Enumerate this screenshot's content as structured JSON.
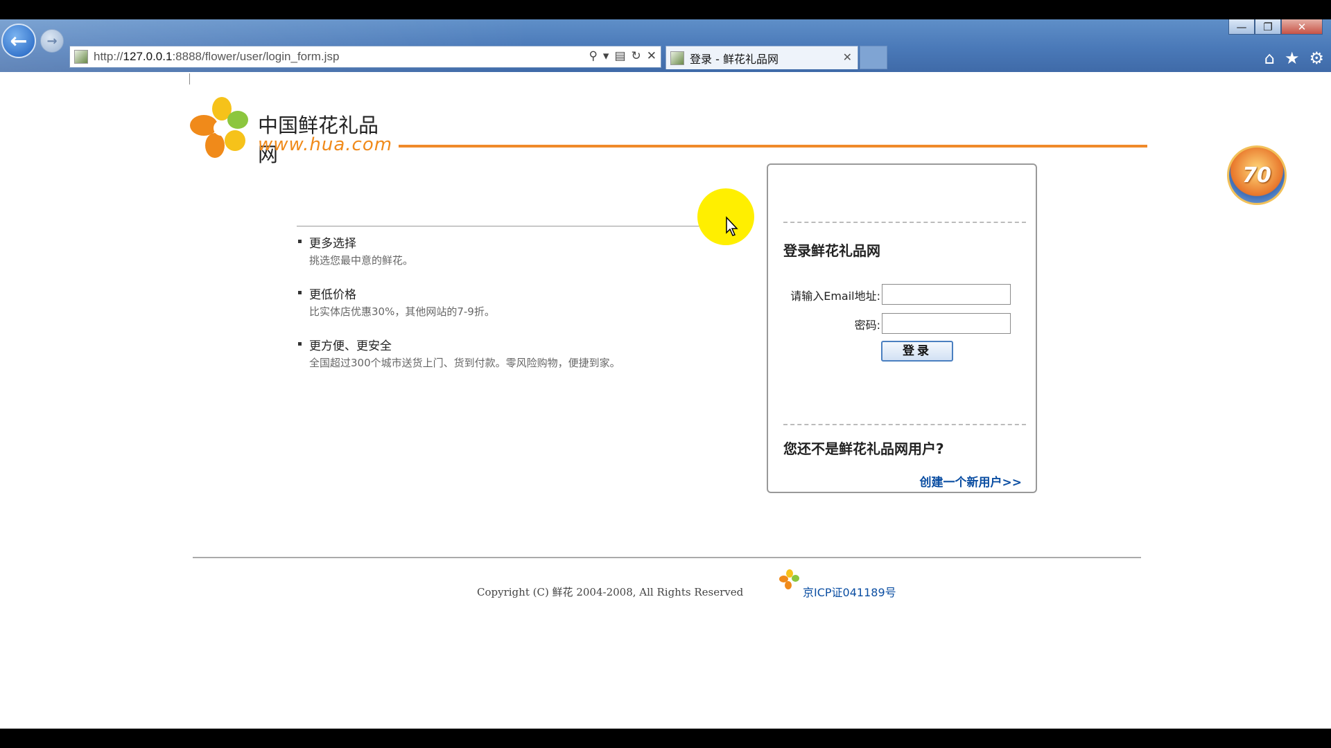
{
  "browser": {
    "url_prefix": "http://",
    "url_host": "127.0.0.1",
    "url_rest": ":8888/flower/user/login_form.jsp",
    "tab_title": "登录 - 鲜花礼品网",
    "win_min": "—",
    "win_max": "❐",
    "win_close": "✕",
    "back": "←",
    "forward": "→",
    "icons": [
      "search-icon",
      "dropdown-icon",
      "compat-icon",
      "refresh-icon",
      "stop-icon",
      "home-icon",
      "favorites-icon",
      "tools-icon"
    ]
  },
  "header": {
    "logo_cn": "中国鲜花礼品网",
    "logo_en": "www.hua.com",
    "badge": "70",
    "accent_color": "#f08a2a"
  },
  "features": [
    {
      "title": "更多选择",
      "desc": "挑选您最中意的鲜花。"
    },
    {
      "title": "更低价格",
      "desc": "比实体店优惠30%，其他网站的7-9折。"
    },
    {
      "title": "更方便、更安全",
      "desc": "全国超过300个城市送货上门、货到付款。零风险购物，便捷到家。"
    }
  ],
  "login": {
    "title": "登录鲜花礼品网",
    "email_label": "请输入Email地址:",
    "email_value": "",
    "password_label": "密码:",
    "password_value": "",
    "submit_label": "登录",
    "register_question": "您还不是鲜花礼品网用户?",
    "register_link": "创建一个新用户>>"
  },
  "footer": {
    "copyright": "Copyright (C) 鲜花 2004-2008, All Rights Reserved",
    "icp": "京ICP证041189号"
  }
}
